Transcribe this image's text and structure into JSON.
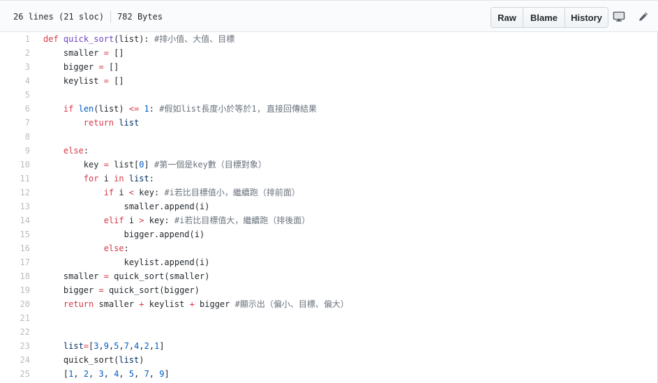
{
  "file_header": {
    "lines_info": "26 lines (21 sloc)",
    "size_info": "782 Bytes",
    "buttons": {
      "raw": "Raw",
      "blame": "Blame",
      "history": "History"
    },
    "icons": [
      "desktop-icon",
      "pencil-icon"
    ]
  },
  "colors": {
    "keyword": "#d73a49",
    "function": "#6f42c1",
    "comment": "#6a737d",
    "number_builtin": "#005cc5"
  },
  "code_lines": [
    {
      "number": "1",
      "tokens": [
        [
          "k",
          "def"
        ],
        [
          "p",
          " "
        ],
        [
          "f",
          "quick_sort"
        ],
        [
          "p",
          "(list): "
        ],
        [
          "c",
          "#排小值、大值、目標"
        ]
      ]
    },
    {
      "number": "2",
      "tokens": [
        [
          "p",
          "    smaller "
        ],
        [
          "k",
          "="
        ],
        [
          "p",
          " []"
        ]
      ]
    },
    {
      "number": "3",
      "tokens": [
        [
          "p",
          "    bigger "
        ],
        [
          "k",
          "="
        ],
        [
          "p",
          " []"
        ]
      ]
    },
    {
      "number": "4",
      "tokens": [
        [
          "p",
          "    keylist "
        ],
        [
          "k",
          "="
        ],
        [
          "p",
          " []"
        ]
      ]
    },
    {
      "number": "5",
      "tokens": []
    },
    {
      "number": "6",
      "tokens": [
        [
          "p",
          "    "
        ],
        [
          "k",
          "if"
        ],
        [
          "p",
          " "
        ],
        [
          "b",
          "len"
        ],
        [
          "p",
          "(list) "
        ],
        [
          "k",
          "<="
        ],
        [
          "p",
          " "
        ],
        [
          "b",
          "1"
        ],
        [
          "p",
          ": "
        ],
        [
          "c",
          "#假如list長度小於等於1, 直接回傳結果"
        ]
      ]
    },
    {
      "number": "7",
      "tokens": [
        [
          "p",
          "        "
        ],
        [
          "k",
          "return"
        ],
        [
          "p",
          " "
        ],
        [
          "bl",
          "list"
        ]
      ]
    },
    {
      "number": "8",
      "tokens": []
    },
    {
      "number": "9",
      "tokens": [
        [
          "p",
          "    "
        ],
        [
          "k",
          "else"
        ],
        [
          "p",
          ":"
        ]
      ]
    },
    {
      "number": "10",
      "tokens": [
        [
          "p",
          "        key "
        ],
        [
          "k",
          "="
        ],
        [
          "p",
          " list["
        ],
        [
          "b",
          "0"
        ],
        [
          "p",
          "] "
        ],
        [
          "c",
          "#第一個是key數（目標對象）"
        ]
      ]
    },
    {
      "number": "11",
      "tokens": [
        [
          "p",
          "        "
        ],
        [
          "k",
          "for"
        ],
        [
          "p",
          " i "
        ],
        [
          "k",
          "in"
        ],
        [
          "p",
          " "
        ],
        [
          "bl",
          "list"
        ],
        [
          "p",
          ":"
        ]
      ]
    },
    {
      "number": "12",
      "tokens": [
        [
          "p",
          "            "
        ],
        [
          "k",
          "if"
        ],
        [
          "p",
          " i "
        ],
        [
          "k",
          "<"
        ],
        [
          "p",
          " key: "
        ],
        [
          "c",
          "#i若比目標值小，繼續跑（排前面）"
        ]
      ]
    },
    {
      "number": "13",
      "tokens": [
        [
          "p",
          "                smaller.append(i)"
        ]
      ]
    },
    {
      "number": "14",
      "tokens": [
        [
          "p",
          "            "
        ],
        [
          "k",
          "elif"
        ],
        [
          "p",
          " i "
        ],
        [
          "k",
          ">"
        ],
        [
          "p",
          " key: "
        ],
        [
          "c",
          "#i若比目標值大，繼續跑（排後面）"
        ]
      ]
    },
    {
      "number": "15",
      "tokens": [
        [
          "p",
          "                bigger.append(i)"
        ]
      ]
    },
    {
      "number": "16",
      "tokens": [
        [
          "p",
          "            "
        ],
        [
          "k",
          "else"
        ],
        [
          "p",
          ":"
        ]
      ]
    },
    {
      "number": "17",
      "tokens": [
        [
          "p",
          "                keylist.append(i)"
        ]
      ]
    },
    {
      "number": "18",
      "tokens": [
        [
          "p",
          "    smaller "
        ],
        [
          "k",
          "="
        ],
        [
          "p",
          " quick_sort(smaller)"
        ]
      ]
    },
    {
      "number": "19",
      "tokens": [
        [
          "p",
          "    bigger "
        ],
        [
          "k",
          "="
        ],
        [
          "p",
          " quick_sort(bigger)"
        ]
      ]
    },
    {
      "number": "20",
      "tokens": [
        [
          "p",
          "    "
        ],
        [
          "k",
          "return"
        ],
        [
          "p",
          " smaller "
        ],
        [
          "k",
          "+"
        ],
        [
          "p",
          " keylist "
        ],
        [
          "k",
          "+"
        ],
        [
          "p",
          " bigger "
        ],
        [
          "c",
          "#顯示出（偏小、目標、偏大）"
        ]
      ]
    },
    {
      "number": "21",
      "tokens": []
    },
    {
      "number": "22",
      "tokens": []
    },
    {
      "number": "23",
      "tokens": [
        [
          "p",
          "    "
        ],
        [
          "bl",
          "list"
        ],
        [
          "k",
          "="
        ],
        [
          "p",
          "["
        ],
        [
          "b",
          "3"
        ],
        [
          "p",
          ","
        ],
        [
          "b",
          "9"
        ],
        [
          "p",
          ","
        ],
        [
          "b",
          "5"
        ],
        [
          "p",
          ","
        ],
        [
          "b",
          "7"
        ],
        [
          "p",
          ","
        ],
        [
          "b",
          "4"
        ],
        [
          "p",
          ","
        ],
        [
          "b",
          "2"
        ],
        [
          "p",
          ","
        ],
        [
          "b",
          "1"
        ],
        [
          "p",
          "]"
        ]
      ]
    },
    {
      "number": "24",
      "tokens": [
        [
          "p",
          "    quick_sort("
        ],
        [
          "bl",
          "list"
        ],
        [
          "p",
          ")"
        ]
      ]
    },
    {
      "number": "25",
      "tokens": [
        [
          "p",
          "    ["
        ],
        [
          "b",
          "1"
        ],
        [
          "p",
          ", "
        ],
        [
          "b",
          "2"
        ],
        [
          "p",
          ", "
        ],
        [
          "b",
          "3"
        ],
        [
          "p",
          ", "
        ],
        [
          "b",
          "4"
        ],
        [
          "p",
          ", "
        ],
        [
          "b",
          "5"
        ],
        [
          "p",
          ", "
        ],
        [
          "b",
          "7"
        ],
        [
          "p",
          ", "
        ],
        [
          "b",
          "9"
        ],
        [
          "p",
          "]"
        ]
      ]
    }
  ]
}
